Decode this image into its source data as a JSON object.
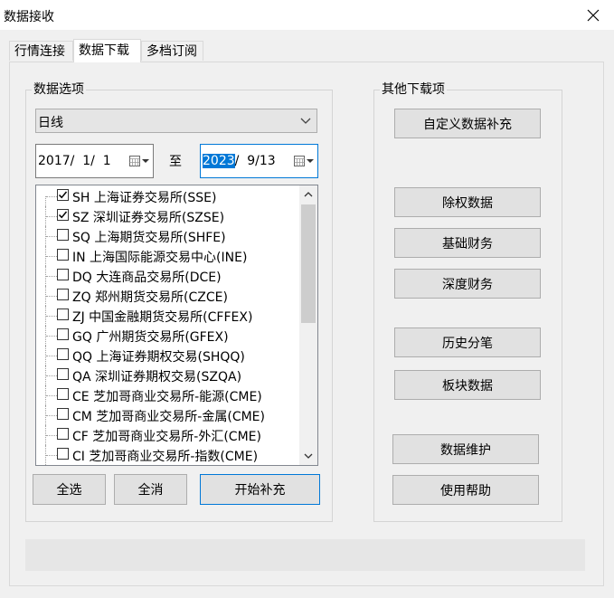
{
  "window": {
    "title": "数据接收",
    "close_glyph": "✕"
  },
  "tabs": [
    {
      "label": "行情连接"
    },
    {
      "label": "数据下载"
    },
    {
      "label": "多档订阅"
    }
  ],
  "data_options": {
    "group_label": "数据选项",
    "period": {
      "value": "日线"
    },
    "start_date": {
      "text": "2017/  1/  1"
    },
    "to_label": "至",
    "end_date": {
      "year": "2023",
      "rest": "/  9/13"
    },
    "markets": [
      {
        "label": "SH 上海证券交易所(SSE)",
        "checked": true
      },
      {
        "label": "SZ 深圳证券交易所(SZSE)",
        "checked": true
      },
      {
        "label": "SQ 上海期货交易所(SHFE)",
        "checked": false
      },
      {
        "label": "IN 上海国际能源交易中心(INE)",
        "checked": false
      },
      {
        "label": "DQ 大连商品交易所(DCE)",
        "checked": false
      },
      {
        "label": "ZQ 郑州期货交易所(CZCE)",
        "checked": false
      },
      {
        "label": "ZJ 中国金融期货交易所(CFFEX)",
        "checked": false
      },
      {
        "label": "GQ 广州期货交易所(GFEX)",
        "checked": false
      },
      {
        "label": "QQ 上海证券期权交易(SHQQ)",
        "checked": false
      },
      {
        "label": "QA 深圳证券期权交易(SZQA)",
        "checked": false
      },
      {
        "label": "CE 芝加哥商业交易所-能源(CME)",
        "checked": false
      },
      {
        "label": "CM 芝加哥商业交易所-金属(CME)",
        "checked": false
      },
      {
        "label": "CF 芝加哥商业交易所-外汇(CME)",
        "checked": false
      },
      {
        "label": "CI 芝加哥商业交易所-指数(CME)",
        "checked": false
      }
    ],
    "buttons": {
      "select_all": "全选",
      "clear_all": "全消",
      "start_fill": "开始补充"
    }
  },
  "other_downloads": {
    "group_label": "其他下载项",
    "buttons": {
      "custom_fill": "自定义数据补充",
      "ex_rights": "除权数据",
      "basic_finance": "基础财务",
      "deep_finance": "深度财务",
      "history_ticks": "历史分笔",
      "sector_data": "板块数据",
      "maintenance": "数据维护",
      "help": "使用帮助"
    }
  },
  "colors": {
    "accent": "#0078d7",
    "button_bg": "#e1e1e1",
    "window_bg": "#f0f0f0"
  }
}
